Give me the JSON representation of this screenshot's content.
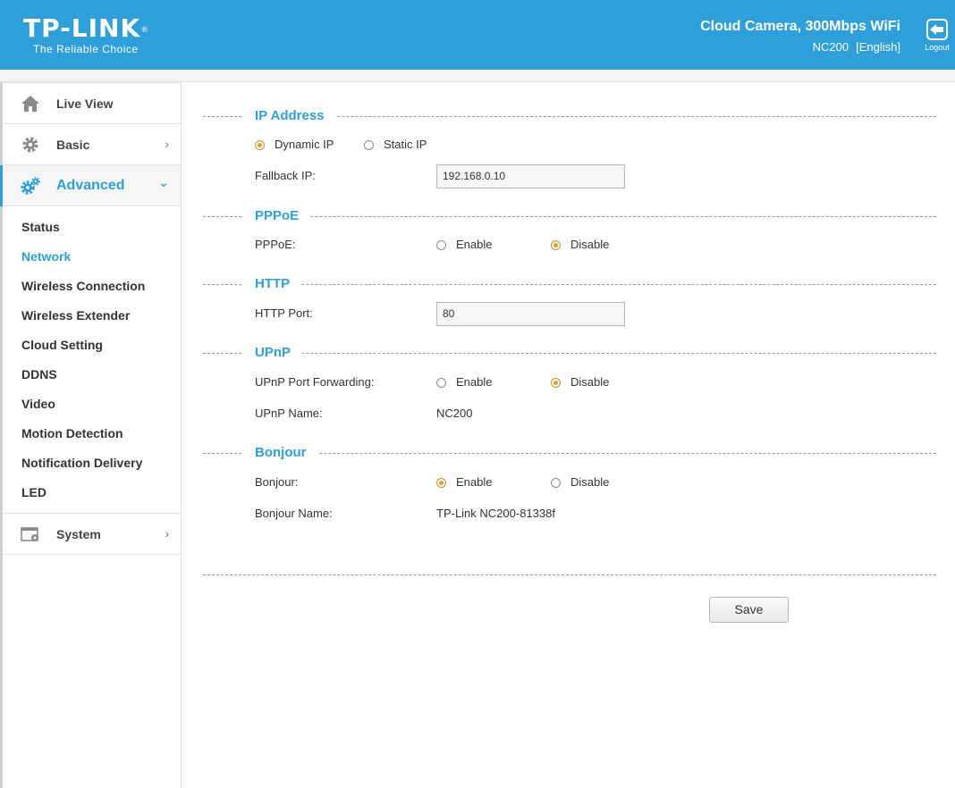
{
  "header": {
    "logo": "TP-LINK",
    "logo_mark": "®",
    "tagline": "The Reliable Choice",
    "product_title": "Cloud Camera, 300Mbps WiFi",
    "model": "NC200",
    "language": "[English]",
    "logout_label": "Logout",
    "background_color": "#2e9fd9"
  },
  "sidebar": {
    "items": [
      {
        "label": "Live View",
        "icon": "home-icon"
      },
      {
        "label": "Basic",
        "icon": "gear-icon",
        "chevron": "›"
      },
      {
        "label": "Advanced",
        "icon": "gears-icon",
        "chevron": "⌄",
        "active": true
      },
      {
        "label": "System",
        "icon": "system-icon",
        "chevron": "›"
      }
    ],
    "advanced_submenu": [
      {
        "label": "Status"
      },
      {
        "label": "Network",
        "current": true
      },
      {
        "label": "Wireless Connection"
      },
      {
        "label": "Wireless Extender"
      },
      {
        "label": "Cloud Setting"
      },
      {
        "label": "DDNS"
      },
      {
        "label": "Video"
      },
      {
        "label": "Motion Detection"
      },
      {
        "label": "Notification Delivery"
      },
      {
        "label": "LED"
      }
    ]
  },
  "sections": {
    "ip_address": {
      "title": "IP Address",
      "options": [
        "Dynamic IP",
        "Static IP"
      ],
      "selected": "Dynamic IP",
      "fallback_label": "Fallback IP:",
      "fallback_value": "192.168.0.10"
    },
    "pppoe": {
      "title": "PPPoE",
      "label": "PPPoE:",
      "options": [
        "Enable",
        "Disable"
      ],
      "selected": "Disable"
    },
    "http": {
      "title": "HTTP",
      "port_label": "HTTP Port:",
      "port_value": "80"
    },
    "upnp": {
      "title": "UPnP",
      "forwarding_label": "UPnP Port Forwarding:",
      "options": [
        "Enable",
        "Disable"
      ],
      "selected": "Disable",
      "name_label": "UPnP Name:",
      "name_value": "NC200"
    },
    "bonjour": {
      "title": "Bonjour",
      "label": "Bonjour:",
      "options": [
        "Enable",
        "Disable"
      ],
      "selected": "Enable",
      "name_label": "Bonjour Name:",
      "name_value": "TP-Link NC200-81338f"
    }
  },
  "actions": {
    "save_label": "Save"
  },
  "colors": {
    "accent": "#2e9fd9",
    "radio_selected": "#e39a35"
  }
}
